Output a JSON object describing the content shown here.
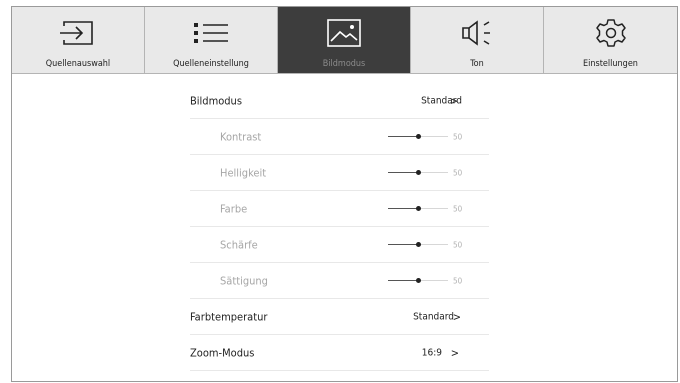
{
  "tabs": [
    {
      "label": "Quellenauswahl",
      "icon": "input-source-icon",
      "active": false
    },
    {
      "label": "Quelleneinstellung",
      "icon": "list-icon",
      "active": false
    },
    {
      "label": "Bildmodus",
      "icon": "picture-icon",
      "active": true
    },
    {
      "label": "Ton",
      "icon": "speaker-icon",
      "active": false
    },
    {
      "label": "Einstellungen",
      "icon": "gear-icon",
      "active": false
    }
  ],
  "settings": {
    "bildmodus": {
      "label": "Bildmodus",
      "value": "Standard",
      "chevron": ">"
    },
    "sliders": [
      {
        "label": "Kontrast",
        "value": "50",
        "level": 0.5
      },
      {
        "label": "Helligkeit",
        "value": "50",
        "level": 0.5
      },
      {
        "label": "Farbe",
        "value": "50",
        "level": 0.5
      },
      {
        "label": "Schärfe",
        "value": "50",
        "level": 0.5
      },
      {
        "label": "Sättigung",
        "value": "50",
        "level": 0.5
      }
    ],
    "farbtemperatur": {
      "label": "Farbtemperatur",
      "value": "Standard",
      "chevron": ">"
    },
    "zoom": {
      "label": "Zoom-Modus",
      "value": "16:9",
      "chevron": ">"
    }
  },
  "colors": {
    "active_tab": "#3d3d3d",
    "tab_bg": "#e9e9e9",
    "disabled_text": "#a6a6a6"
  }
}
